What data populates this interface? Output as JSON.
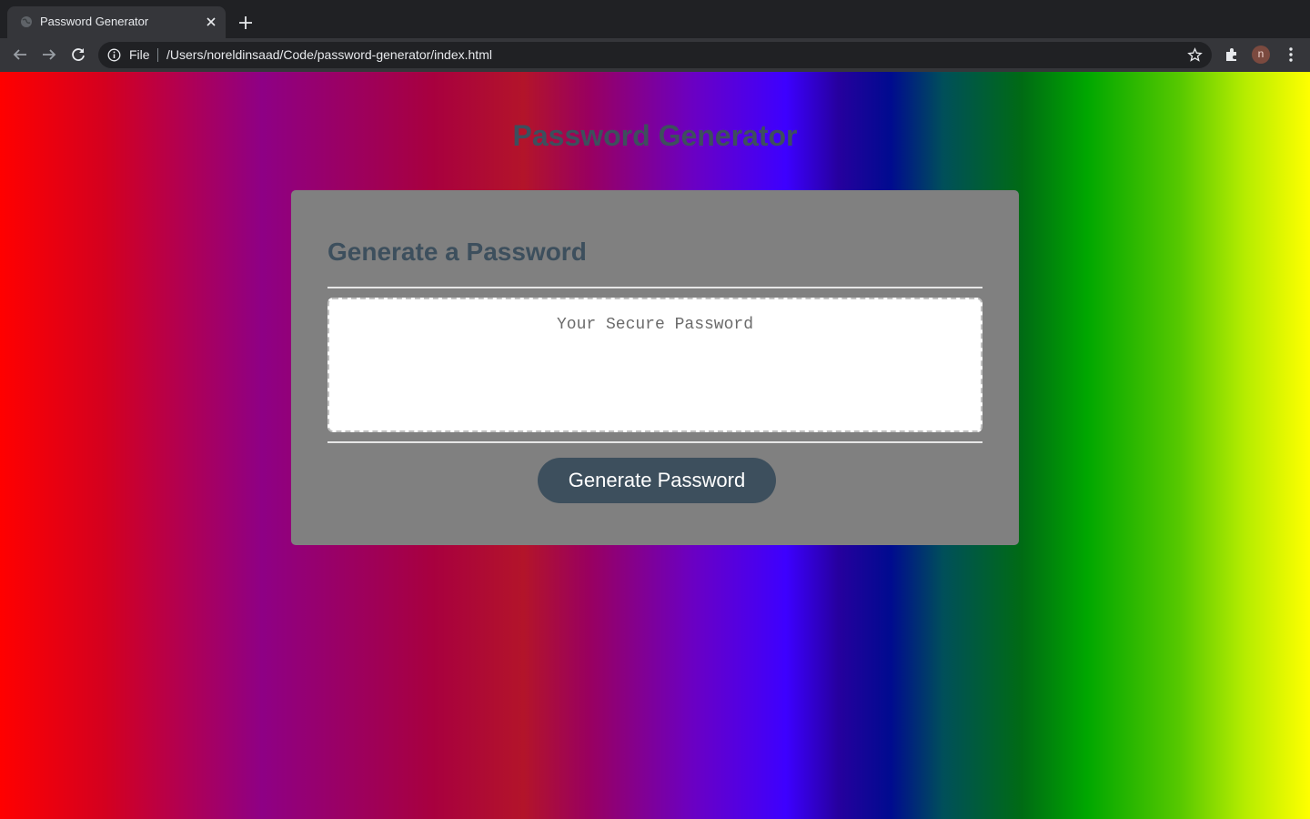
{
  "browser": {
    "tab_title": "Password Generator",
    "scheme_label": "File",
    "url": "/Users/noreldinsaad/Code/password-generator/index.html",
    "profile_initial": "n"
  },
  "page": {
    "title": "Password Generator",
    "card_title": "Generate a Password",
    "password_placeholder": "Your Secure Password",
    "password_value": "",
    "generate_button_label": "Generate Password"
  },
  "colors": {
    "heading": "#3d4f5d",
    "card_background": "#808080",
    "button_background": "#3d4f5d"
  },
  "icons": [
    "globe-icon",
    "close-icon",
    "plus-icon",
    "back-arrow-icon",
    "forward-arrow-icon",
    "reload-icon",
    "info-icon",
    "star-icon",
    "puzzle-icon",
    "kebab-menu-icon"
  ]
}
